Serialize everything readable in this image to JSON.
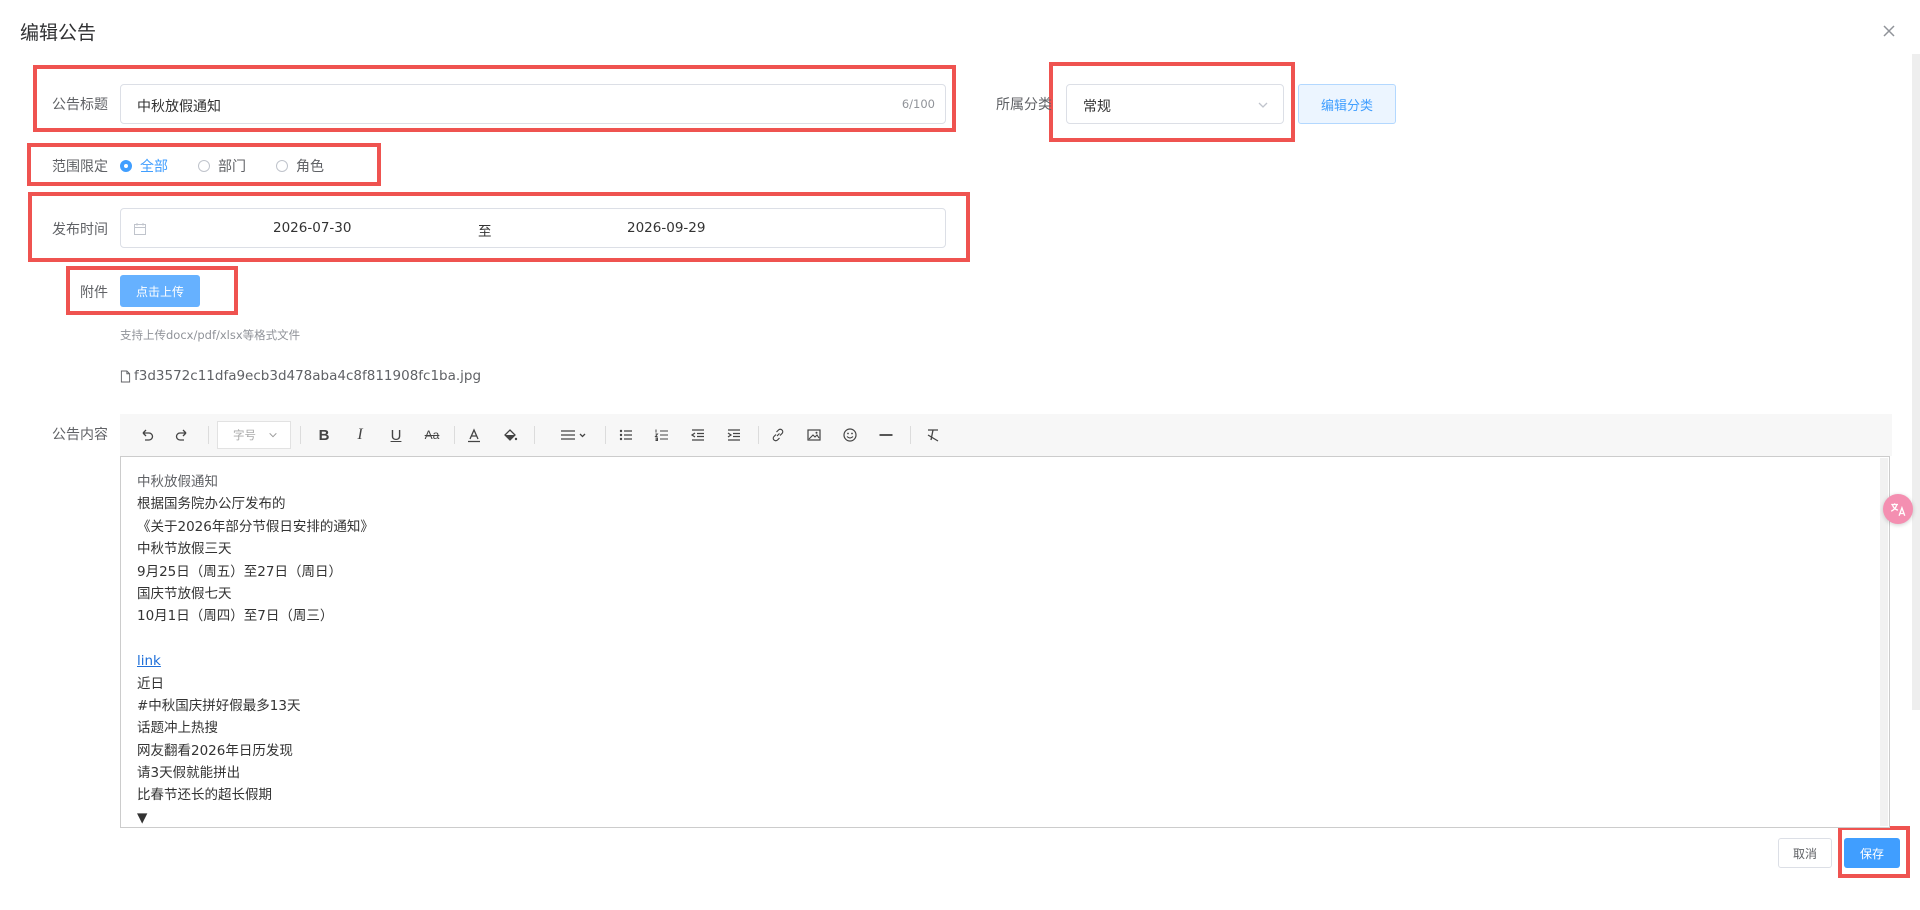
{
  "dialog": {
    "title": "编辑公告",
    "close_icon": "close-icon"
  },
  "form": {
    "title_label": "公告标题",
    "title_value": "中秋放假通知",
    "title_count": "6/100",
    "category_label": "所属分类",
    "category_value": "常规",
    "edit_category_button": "编辑分类",
    "scope_label": "范围限定",
    "scope_options": [
      {
        "label": "全部",
        "selected": true
      },
      {
        "label": "部门",
        "selected": false
      },
      {
        "label": "角色",
        "selected": false
      }
    ],
    "publish_label": "发布时间",
    "publish_start": "2026-07-30",
    "publish_separator": "至",
    "publish_end": "2026-09-29",
    "attachment_label": "附件",
    "upload_button": "点击上传",
    "upload_hint": "支持上传docx/pdf/xlsx等格式文件",
    "attachment_file": "f3d3572c11dfa9ecb3d478aba4c8f811908fc1ba.jpg",
    "content_label": "公告内容"
  },
  "toolbar": {
    "font_size_placeholder": "字号",
    "tools": [
      "undo-icon",
      "redo-icon",
      "bold-icon",
      "italic-icon",
      "underline-icon",
      "strikethrough-icon",
      "font-color-icon",
      "background-color-icon",
      "align-icon",
      "bullet-list-icon",
      "numbered-list-icon",
      "outdent-icon",
      "indent-icon",
      "link-icon",
      "image-icon",
      "emoji-icon",
      "horizontal-rule-icon",
      "clear-format-icon"
    ]
  },
  "editor": {
    "lines": [
      "中秋放假通知",
      "根据国务院办公厅发布的",
      "《关于2026年部分节假日安排的通知》",
      "中秋节放假三天",
      "9月25日（周五）至27日（周日）",
      "国庆节放假七天",
      "10月1日（周四）至7日（周三）",
      "",
      "link",
      "近日",
      "#中秋国庆拼好假最多13天",
      "话题冲上热搜",
      "网友翻看2026年日历发现",
      "请3天假就能拼出",
      "比春节还长的超长假期",
      "▼"
    ]
  },
  "footer": {
    "cancel_button": "取消",
    "save_button": "保存"
  },
  "colors": {
    "primary": "#409eff",
    "highlight_border": "#ef5350"
  }
}
